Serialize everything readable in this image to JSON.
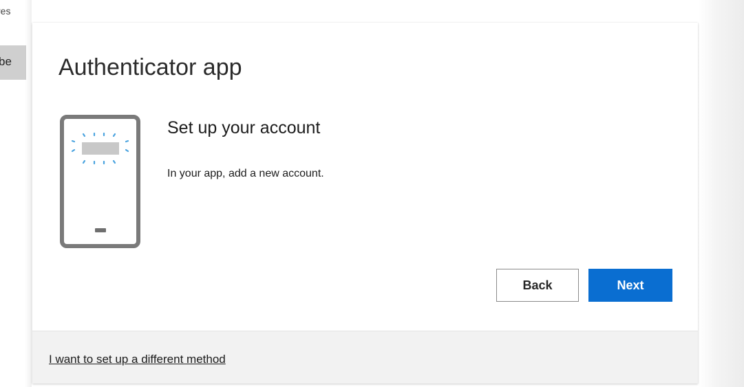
{
  "background": {
    "fragment_top": "res",
    "fragment_mid": "be"
  },
  "modal": {
    "title": "Authenticator app",
    "step_heading": "Set up your account",
    "step_text": "In your app, add a new account.",
    "illustration_icon": "phone-qr-icon",
    "buttons": {
      "back_label": "Back",
      "next_label": "Next"
    },
    "footer_link": "I want to set up a different method"
  },
  "colors": {
    "primary": "#0a6ed1",
    "phone_outline": "#7a7a7a",
    "sparkle": "#4aa3df",
    "footer_bg": "#f2f2f2"
  }
}
